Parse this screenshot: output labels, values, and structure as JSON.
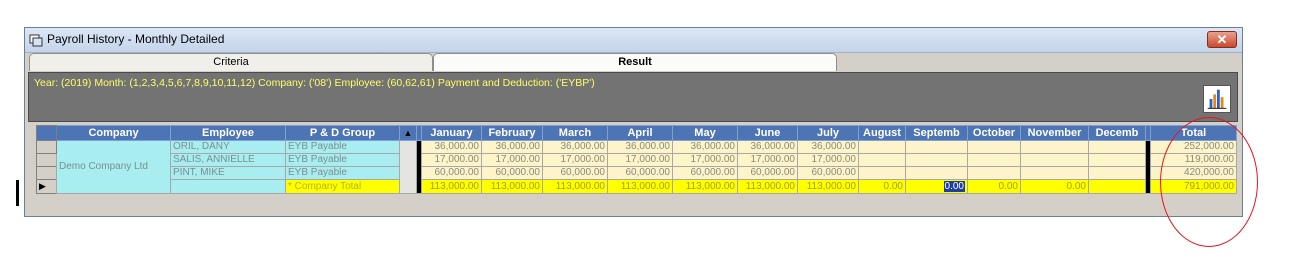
{
  "window": {
    "title": "Payroll History - Monthly Detailed",
    "close_label": "✕"
  },
  "tabs": [
    {
      "label": "Criteria"
    },
    {
      "label": "Result"
    }
  ],
  "info": {
    "text": "Year: (2019) Month: (1,2,3,4,5,6,7,8,9,10,11,12) Company: ('08') Employee: (60,62,61) Payment and Deduction: ('EYBP')"
  },
  "grid": {
    "columns": {
      "company": "Company",
      "employee": "Employee",
      "pd_group": "P & D Group",
      "months": [
        "January",
        "February",
        "March",
        "April",
        "May",
        "June",
        "July",
        "August",
        "Septemb",
        "October",
        "November",
        "Decemb"
      ],
      "total": "Total"
    },
    "company_name": "Demo Company Ltd",
    "rows": [
      {
        "employee": "ORIL, DANY",
        "group": "EYB Payable",
        "values": [
          "36,000.00",
          "36,000.00",
          "36,000.00",
          "36,000.00",
          "36,000.00",
          "36,000.00",
          "36,000.00",
          "",
          "",
          "",
          "",
          ""
        ],
        "total": "252,000.00"
      },
      {
        "employee": "SALIS, ANNIELLE",
        "group": "EYB Payable",
        "values": [
          "17,000.00",
          "17,000.00",
          "17,000.00",
          "17,000.00",
          "17,000.00",
          "17,000.00",
          "17,000.00",
          "",
          "",
          "",
          "",
          ""
        ],
        "total": "119,000.00"
      },
      {
        "employee": "PINT, MIKE",
        "group": "EYB Payable",
        "values": [
          "60,000.00",
          "60,000.00",
          "60,000.00",
          "60,000.00",
          "60,000.00",
          "60,000.00",
          "60,000.00",
          "",
          "",
          "",
          "",
          ""
        ],
        "total": "420,000.00"
      }
    ],
    "total_row": {
      "group": "* Company Total",
      "values": [
        "113,000.00",
        "113,000.00",
        "113,000.00",
        "113,000.00",
        "113,000.00",
        "113,000.00",
        "113,000.00",
        "0.00",
        "0.00",
        "0.00",
        "0.00",
        ""
      ],
      "total": "791,000.00"
    }
  },
  "colors": {
    "header": "#4d75b5",
    "employee_cells": "#a8eef0",
    "value_cells": "#fdf5c9",
    "total_row": "#ffff00",
    "annotation": "#e8121a"
  }
}
